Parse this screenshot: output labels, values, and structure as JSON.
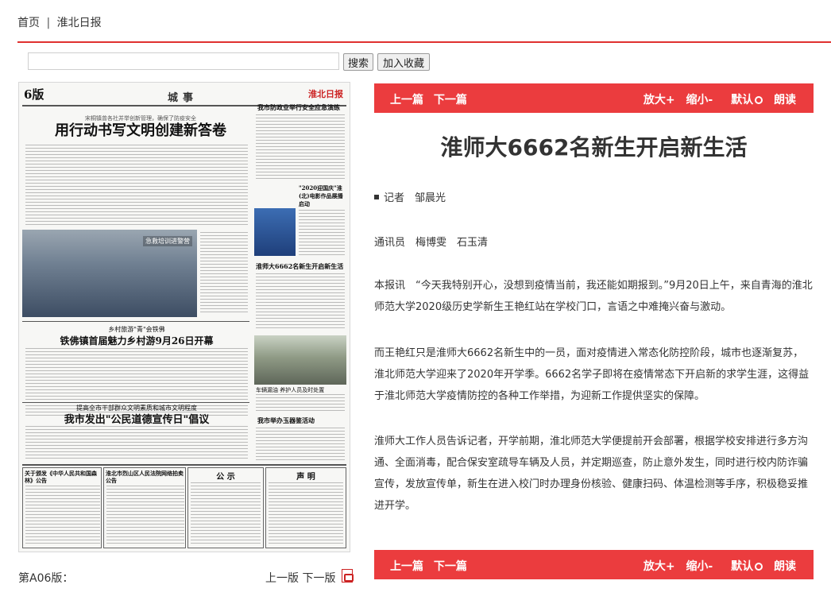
{
  "topnav": {
    "home": "首页",
    "separator": "|",
    "site": "淮北日报"
  },
  "search": {
    "value": "",
    "placeholder": "",
    "search_label": "搜索",
    "favorite_label": "加入收藏"
  },
  "paper": {
    "edition": "6版",
    "section": "城事",
    "logo": "淮北日报",
    "kicker": "宋桐镇曾各社并举创新管理，确保了防疫安全",
    "headline": "用行动书写文明创建新答卷",
    "photo_caption": "急救培训进警营",
    "h_tourism_kicker": "乡村旅游\"青\"会铁佛",
    "h_tourism": "铁佛镇首届魅力乡村游9月26日开幕",
    "h_campaign_kicker": "提高全市干部群众文明素质和城市文明程度",
    "h_campaign": "我市发出\"公民道德宣传日\"倡议",
    "h_right1": "我市防政业举行安全应急演练",
    "h_right2": "\"2020迎国庆\"淮(北)电影作品展播启动",
    "h_right3": "淮师大6662名新生开启新生活",
    "h_right4": "车辆漏油 养护人员及时处置",
    "h_right5": "我市举办玉器鉴活动",
    "notice1": "关于颁发《中华人民共和国森林》公告",
    "notice2": "淮北市烈山区人民法院网络拍卖公告",
    "notice3": "公 示",
    "notice4": "声 明"
  },
  "article_bar": {
    "prev": "上一篇",
    "next": "下一篇",
    "zoom_in": "放大+",
    "zoom_out": "缩小-",
    "default": "默认",
    "read": "朗读"
  },
  "article": {
    "title": "淮师大6662名新生开启新生活",
    "reporter": "记者　邹晨光",
    "correspondents": "通讯员　梅博雯　石玉清",
    "paragraphs": [
      "本报讯　“今天我特别开心，没想到疫情当前，我还能如期报到。”9月20日上午，来自青海的淮北师范大学2020级历史学新生王艳红站在学校门口，言语之中难掩兴奋与激动。",
      "而王艳红只是淮师大6662名新生中的一员，面对疫情进入常态化防控阶段，城市也逐渐复苏，淮北师范大学迎来了2020年开学季。6662名学子即将在疫情常态下开启新的求学生涯，这得益于淮北师范大学疫情防控的各种工作举措，为迎新工作提供坚实的保障。",
      "淮师大工作人员告诉记者，开学前期，淮北师范大学便提前开会部署，根据学校安排进行多方沟通、全面消毒，配合保安室疏导车辆及人员，并定期巡查，防止意外发生，同时进行校内防诈骗宣传，发放宣传单，新生在进入校门时办理身份核验、健康扫码、体温检测等手序，积极稳妥推进开学。"
    ]
  },
  "footer": {
    "edition_label": "第A06版：",
    "prev_page": "上一版",
    "next_page": "下一版"
  },
  "colors": {
    "accent_red": "#eb3c3e",
    "rule_red": "#e0312f"
  }
}
